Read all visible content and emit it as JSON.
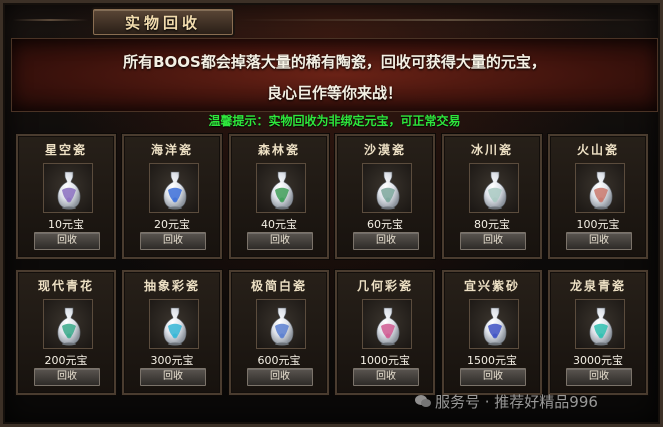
{
  "window": {
    "title": "实物回收"
  },
  "banner": {
    "line1": "所有BOOS都会掉落大量的稀有陶瓷，回收可获得大量的元宝，",
    "line2": "良心巨作等你来战！"
  },
  "tip": "温馨提示：实物回收为非绑定元宝，可正常交易",
  "items": [
    {
      "name": "星空瓷",
      "price": "10元宝",
      "button": "回收",
      "color": "#8a6fc0"
    },
    {
      "name": "海洋瓷",
      "price": "20元宝",
      "button": "回收",
      "color": "#3c6fd8"
    },
    {
      "name": "森林瓷",
      "price": "40元宝",
      "button": "回收",
      "color": "#3f9e58"
    },
    {
      "name": "沙漠瓷",
      "price": "60元宝",
      "button": "回收",
      "color": "#7ca79c"
    },
    {
      "name": "冰川瓷",
      "price": "80元宝",
      "button": "回收",
      "color": "#a9c9c2"
    },
    {
      "name": "火山瓷",
      "price": "100元宝",
      "button": "回收",
      "color": "#c9786c"
    },
    {
      "name": "现代青花",
      "price": "200元宝",
      "button": "回收",
      "color": "#3aa98a"
    },
    {
      "name": "抽象彩瓷",
      "price": "300元宝",
      "button": "回收",
      "color": "#35b6d6"
    },
    {
      "name": "极简白瓷",
      "price": "600元宝",
      "button": "回收",
      "color": "#5a7fd0"
    },
    {
      "name": "几何彩瓷",
      "price": "1000元宝",
      "button": "回收",
      "color": "#d05a92"
    },
    {
      "name": "宜兴紫砂",
      "price": "1500元宝",
      "button": "回收",
      "color": "#3f52c4"
    },
    {
      "name": "龙泉青瓷",
      "price": "3000元宝",
      "button": "回收",
      "color": "#2fbfb0"
    }
  ],
  "watermark": "服务号 · 推荐好精品996"
}
